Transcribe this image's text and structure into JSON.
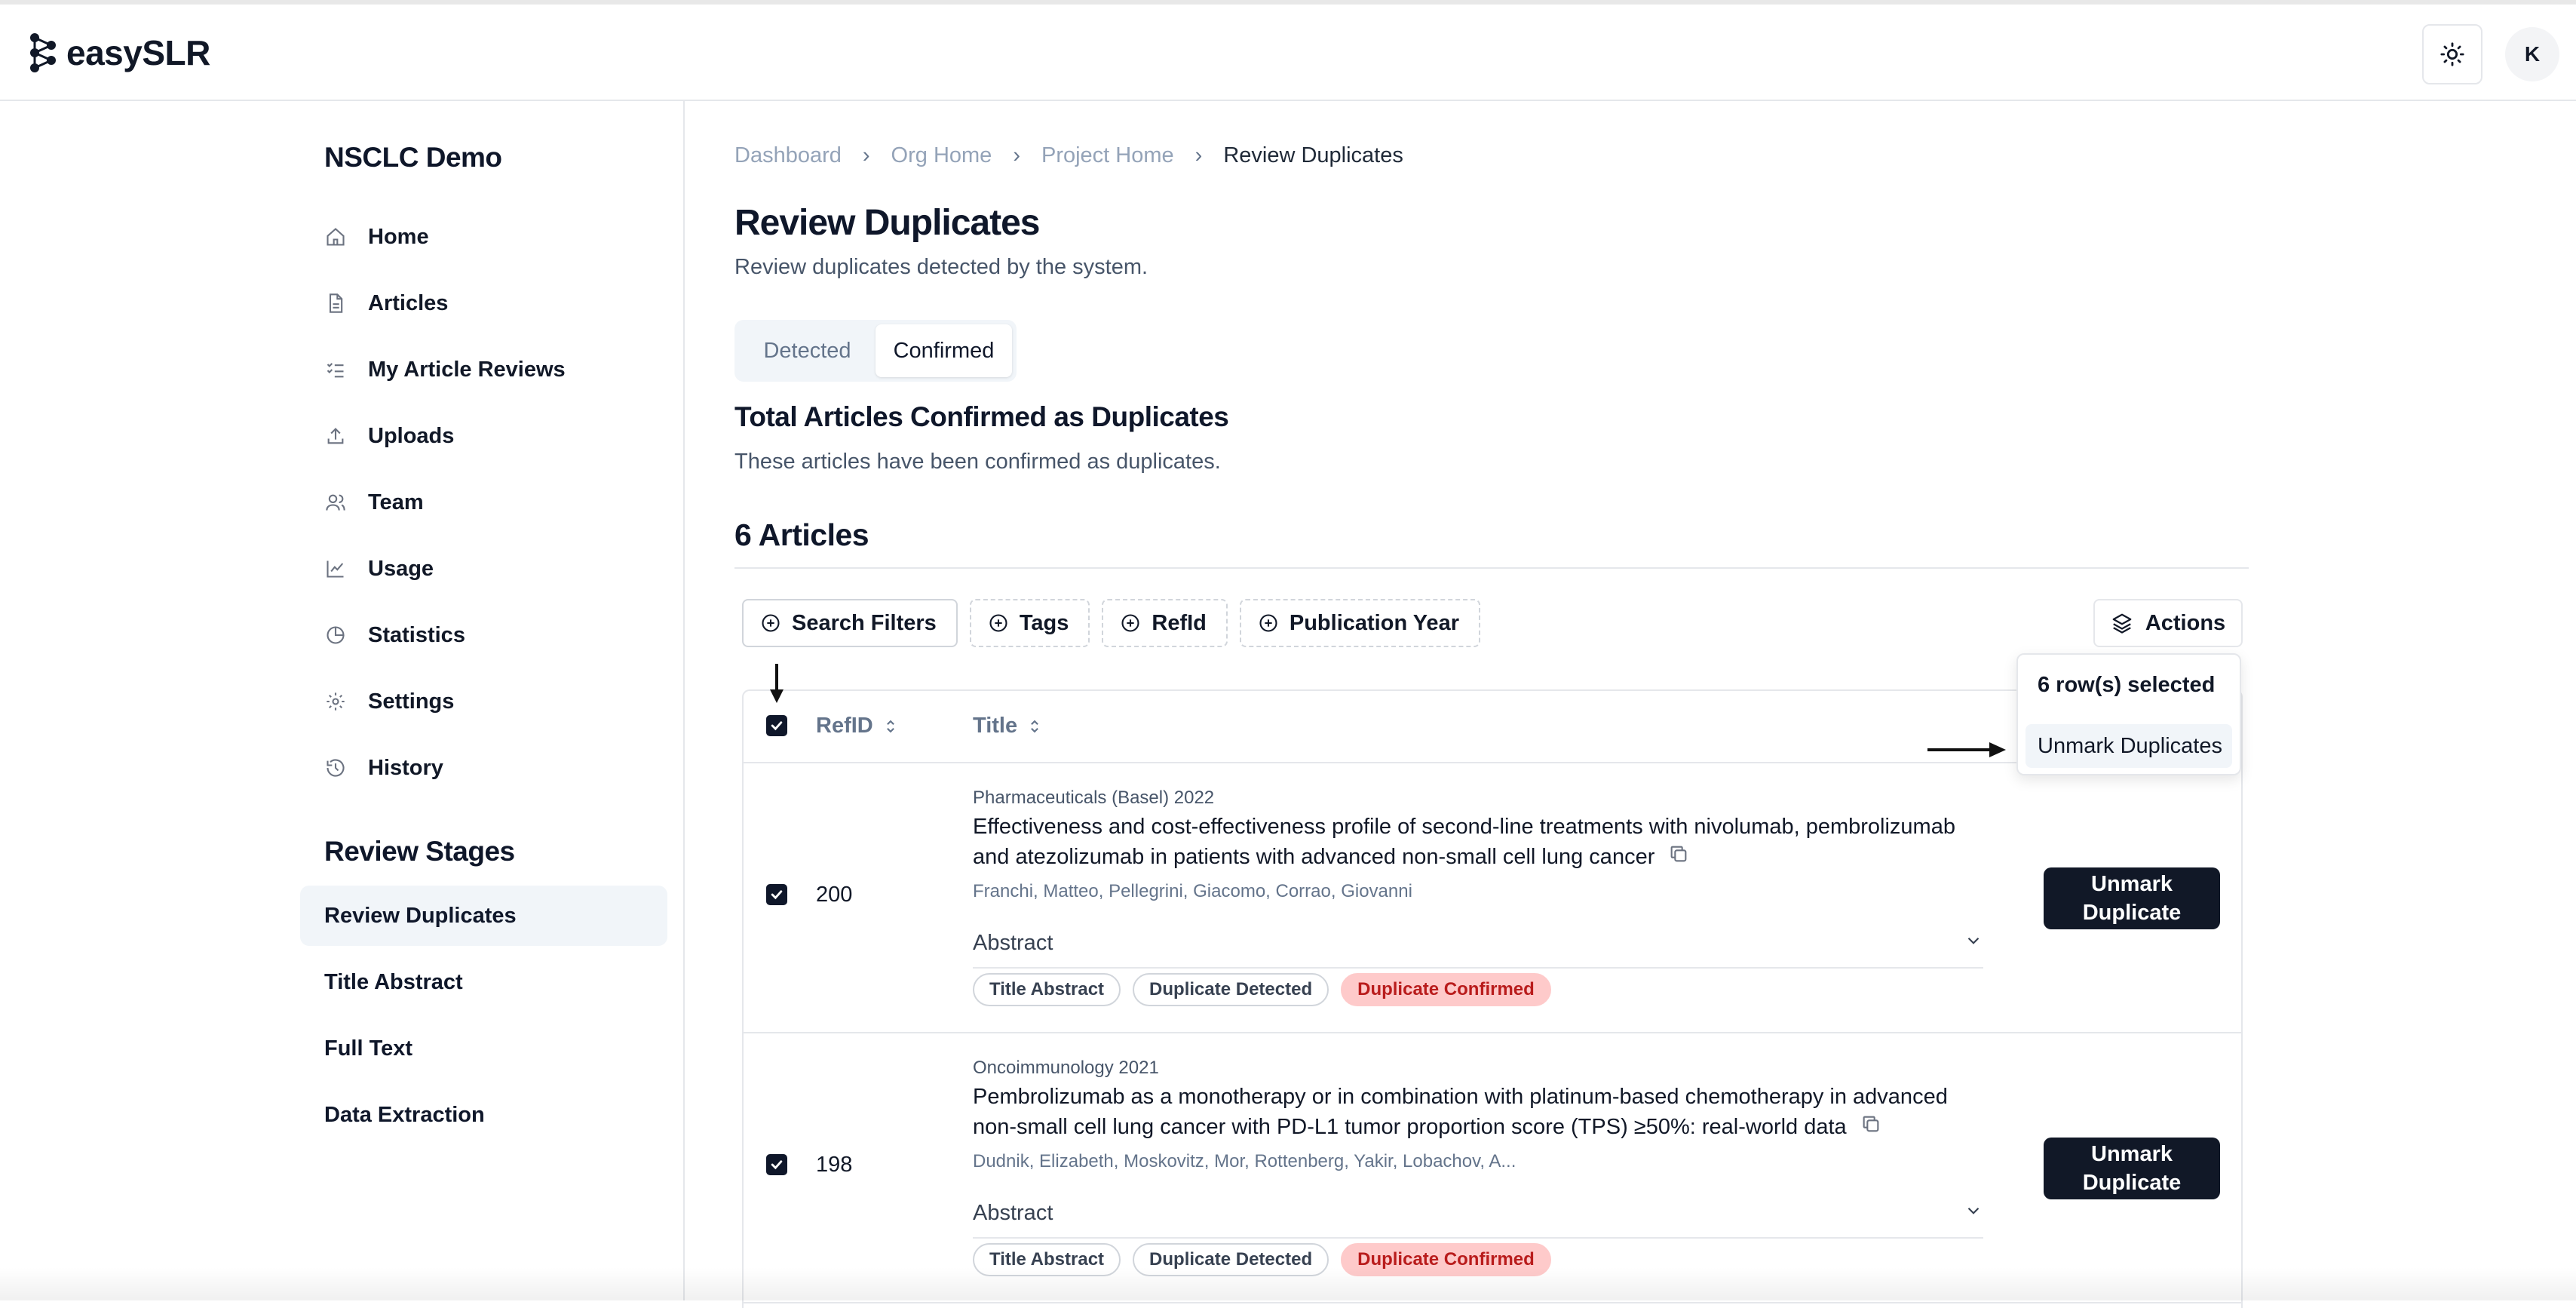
{
  "app": {
    "logo_text": "easySLR",
    "avatar_initial": "K"
  },
  "sidebar": {
    "project_name": "NSCLC Demo",
    "items": [
      {
        "label": "Home",
        "icon": "home-icon"
      },
      {
        "label": "Articles",
        "icon": "file-icon"
      },
      {
        "label": "My Article Reviews",
        "icon": "list-check-icon"
      },
      {
        "label": "Uploads",
        "icon": "upload-icon"
      },
      {
        "label": "Team",
        "icon": "users-icon"
      },
      {
        "label": "Usage",
        "icon": "line-chart-icon"
      },
      {
        "label": "Statistics",
        "icon": "pie-chart-icon"
      },
      {
        "label": "Settings",
        "icon": "gear-icon"
      },
      {
        "label": "History",
        "icon": "history-icon"
      }
    ],
    "stages_title": "Review Stages",
    "stages": [
      {
        "label": "Review Duplicates",
        "active": true
      },
      {
        "label": "Title Abstract"
      },
      {
        "label": "Full Text"
      },
      {
        "label": "Data Extraction"
      }
    ]
  },
  "breadcrumb": [
    "Dashboard",
    "Org Home",
    "Project Home",
    "Review Duplicates"
  ],
  "page": {
    "title": "Review Duplicates",
    "subtitle": "Review duplicates detected by the system."
  },
  "tabs": [
    {
      "label": "Detected"
    },
    {
      "label": "Confirmed",
      "active": true
    }
  ],
  "section": {
    "title": "Total Articles Confirmed as Duplicates",
    "subtitle": "These articles have been confirmed as duplicates.",
    "count": "6 Articles"
  },
  "filters": [
    "Search Filters",
    "Tags",
    "RefId",
    "Publication Year"
  ],
  "actions": {
    "label": "Actions",
    "dropdown_header": "6 row(s) selected",
    "dropdown_item": "Unmark Duplicates"
  },
  "table": {
    "headers": {
      "refid": "RefID",
      "title": "Title"
    },
    "rows": [
      {
        "refid": "200",
        "journal": "Pharmaceuticals (Basel) 2022",
        "title": "Effectiveness and cost-effectiveness profile of second-line treatments with nivolumab, pembrolizumab and atezolizumab in patients with advanced non-small cell lung cancer",
        "authors": "Franchi, Matteo, Pellegrini, Giacomo, Corrao, Giovanni",
        "abstract_label": "Abstract",
        "tags": [
          "Title Abstract",
          "Duplicate Detected",
          "Duplicate Confirmed"
        ],
        "button": "Unmark Duplicate",
        "checked": true
      },
      {
        "refid": "198",
        "journal": "Oncoimmunology 2021",
        "title": "Pembrolizumab as a monotherapy or in combination with platinum-based chemotherapy in advanced non-small cell lung cancer with PD-L1 tumor proportion score (TPS) ≥50%: real-world data",
        "authors": "Dudnik, Elizabeth, Moskovitz, Mor, Rottenberg, Yakir, Lobachov, A...",
        "abstract_label": "Abstract",
        "tags": [
          "Title Abstract",
          "Duplicate Detected",
          "Duplicate Confirmed"
        ],
        "button": "Unmark Duplicate",
        "checked": true
      }
    ]
  },
  "colors": {
    "primary": "#111827",
    "tag_red_bg": "#fecaca",
    "tag_red_text": "#b91c1c",
    "muted": "#64748b"
  }
}
